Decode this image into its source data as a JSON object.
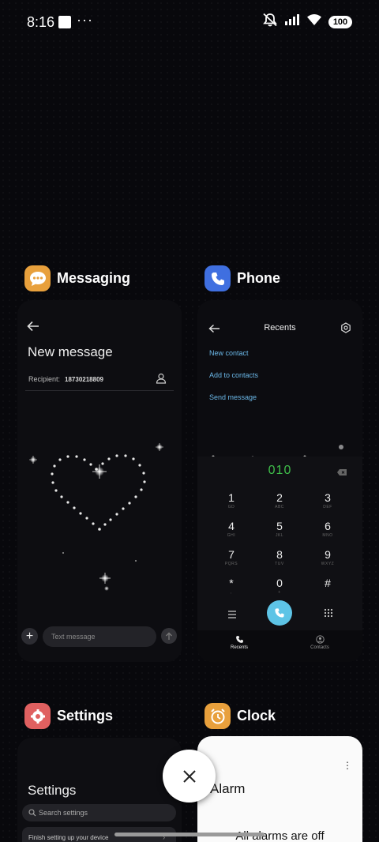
{
  "status_bar": {
    "time": "8:16",
    "more": "···",
    "battery": "100",
    "icons": [
      "notification-square-icon",
      "mute-icon",
      "signal-icon",
      "wifi-icon",
      "battery-icon"
    ]
  },
  "apps": {
    "messaging": {
      "name": "Messaging",
      "icon_color": "#e8a03c",
      "screen": {
        "title": "New message",
        "recipient_label": "Recipient:",
        "recipient_value": "18730218809",
        "input_placeholder": "Text message"
      }
    },
    "phone": {
      "name": "Phone",
      "icon_color": "#3f6fe0",
      "screen": {
        "title": "Recents",
        "links": [
          "New contact",
          "Add to contacts",
          "Send message"
        ],
        "dialed_number": "010",
        "keys": [
          {
            "digit": "1",
            "letters": "GD"
          },
          {
            "digit": "2",
            "letters": "ABC"
          },
          {
            "digit": "3",
            "letters": "DEF"
          },
          {
            "digit": "4",
            "letters": "GHI"
          },
          {
            "digit": "5",
            "letters": "JKL"
          },
          {
            "digit": "6",
            "letters": "MNO"
          },
          {
            "digit": "7",
            "letters": "PQRS"
          },
          {
            "digit": "8",
            "letters": "TUV"
          },
          {
            "digit": "9",
            "letters": "WXYZ"
          },
          {
            "digit": "*",
            "letters": ","
          },
          {
            "digit": "0",
            "letters": "+"
          },
          {
            "digit": "#",
            "letters": ""
          }
        ],
        "tabs": [
          "Recents",
          "Contacts"
        ]
      }
    },
    "settings": {
      "name": "Settings",
      "icon_color": "#e06060",
      "screen": {
        "title": "Settings",
        "search_placeholder": "Search settings",
        "row": "Finish setting up your device"
      }
    },
    "clock": {
      "name": "Clock",
      "icon_color": "#e8a03c",
      "screen": {
        "title": "Alarm",
        "empty_text": "All alarms are off"
      }
    }
  },
  "accent_colors": {
    "dialed": "#3fbf4a",
    "link": "#6bb8e8",
    "call_button": "#5ec4e6"
  }
}
